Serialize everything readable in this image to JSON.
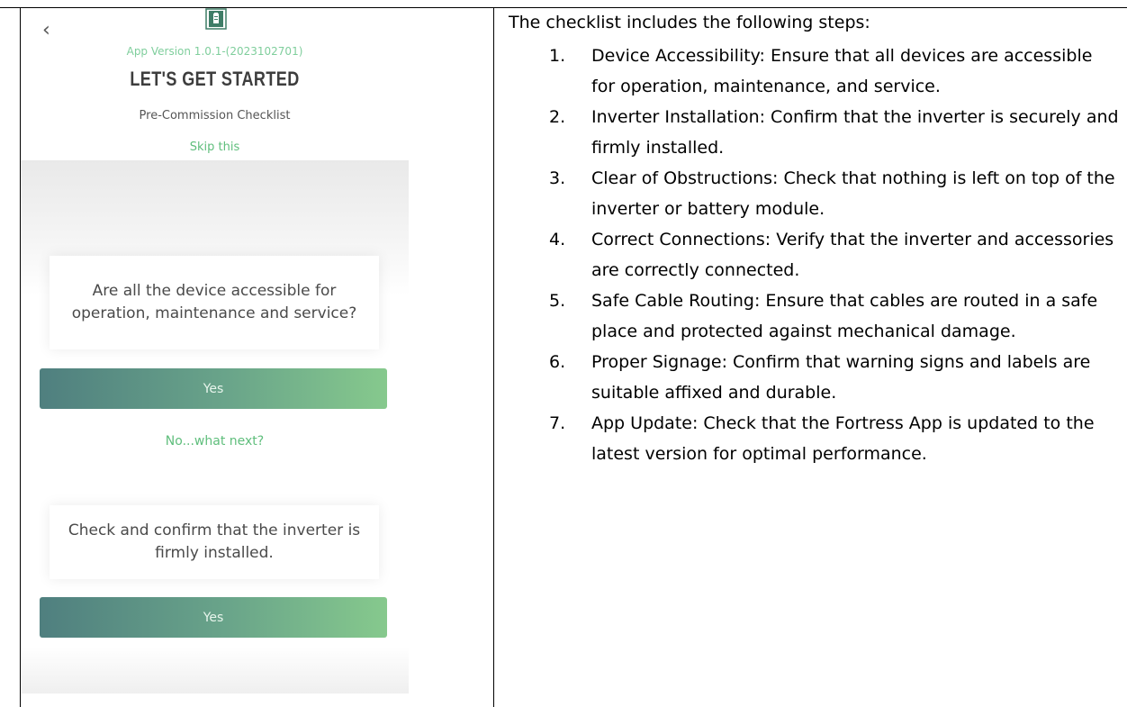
{
  "phone": {
    "back_icon": "chevron-left-icon",
    "logo_icon": "app-logo-icon",
    "app_version": "App Version 1.0.1-(2023102701)",
    "headline": "LET'S GET STARTED",
    "subtitle": "Pre-Commission Checklist",
    "skip_link": "Skip this",
    "questions": [
      {
        "text": "Are all the device accessible for operation, maintenance and service?",
        "yes_label": "Yes"
      },
      {
        "text": "Check and confirm that the inverter is firmly installed.",
        "yes_label": "Yes"
      }
    ],
    "no_link": "No...what next?",
    "colors": {
      "accent_green": "#5fbe7c",
      "button_start": "#4f7f7f",
      "button_end": "#86c98d"
    }
  },
  "document": {
    "intro": "The checklist includes the following steps:",
    "steps": [
      {
        "num": "1.",
        "text": "Device Accessibility: Ensure that all devices are accessible for operation, maintenance, and service."
      },
      {
        "num": "2.",
        "text": "Inverter Installation: Confirm that the inverter is securely and firmly installed."
      },
      {
        "num": "3.",
        "text": "Clear of Obstructions: Check that nothing is left on top of the inverter or battery module."
      },
      {
        "num": "4.",
        "text": "Correct Connections: Verify that the inverter and accessories are correctly connected."
      },
      {
        "num": "5.",
        "text": "Safe Cable Routing: Ensure that cables are routed in a safe place and protected against mechanical damage."
      },
      {
        "num": "6.",
        "text": "Proper Signage: Confirm that warning signs and labels are suitable affixed and durable."
      },
      {
        "num": "7.",
        "text": "App Update: Check that the Fortress App is updated to the latest version for optimal performance."
      }
    ]
  }
}
